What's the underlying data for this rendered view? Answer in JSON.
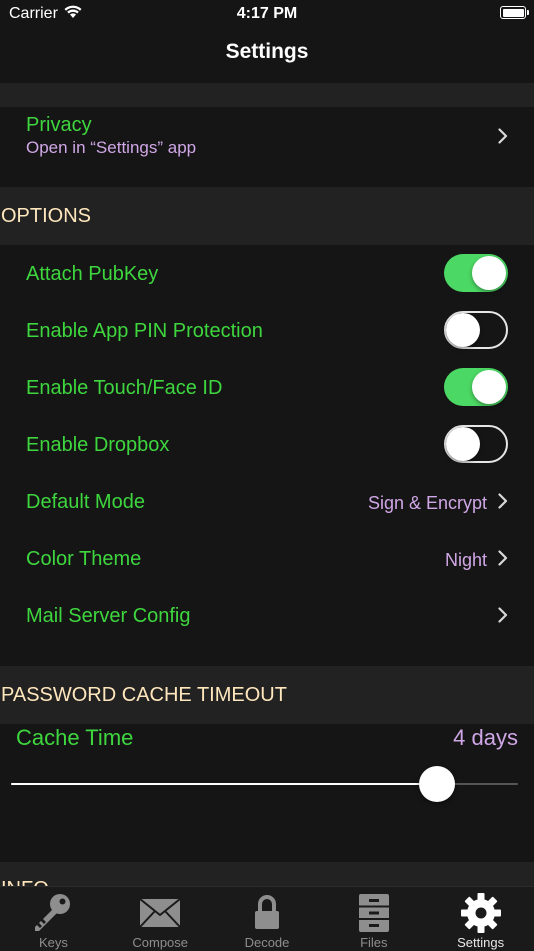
{
  "status_bar": {
    "carrier": "Carrier",
    "time": "4:17 PM"
  },
  "nav": {
    "title": "Settings"
  },
  "privacy": {
    "title": "Privacy",
    "subtitle": "Open in “Settings” app"
  },
  "options": {
    "header": "OPTIONS",
    "rows": [
      {
        "label": "Attach PubKey",
        "toggle": "on"
      },
      {
        "label": "Enable App PIN Protection",
        "toggle": "off"
      },
      {
        "label": "Enable Touch/Face ID",
        "toggle": "on"
      },
      {
        "label": "Enable Dropbox",
        "toggle": "off"
      },
      {
        "label": "Default Mode",
        "value": "Sign & Encrypt"
      },
      {
        "label": "Color Theme",
        "value": "Night"
      },
      {
        "label": "Mail Server Config"
      }
    ]
  },
  "cache": {
    "header": "PASSWORD CACHE TIMEOUT",
    "label": "Cache Time",
    "value": "4 days",
    "slider_fraction": 0.84
  },
  "info": {
    "header": "INFO"
  },
  "tabs": [
    {
      "label": "Keys",
      "icon": "key-icon",
      "active": false
    },
    {
      "label": "Compose",
      "icon": "envelope-icon",
      "active": false
    },
    {
      "label": "Decode",
      "icon": "lock-icon",
      "active": false
    },
    {
      "label": "Files",
      "icon": "file-cabinet-icon",
      "active": false
    },
    {
      "label": "Settings",
      "icon": "gear-icon",
      "active": true
    }
  ],
  "colors": {
    "label_green": "#3ed63e",
    "value_purple": "#d0a7e6",
    "header_cream": "#ffe7bd",
    "toggle_on": "#4cd864"
  }
}
